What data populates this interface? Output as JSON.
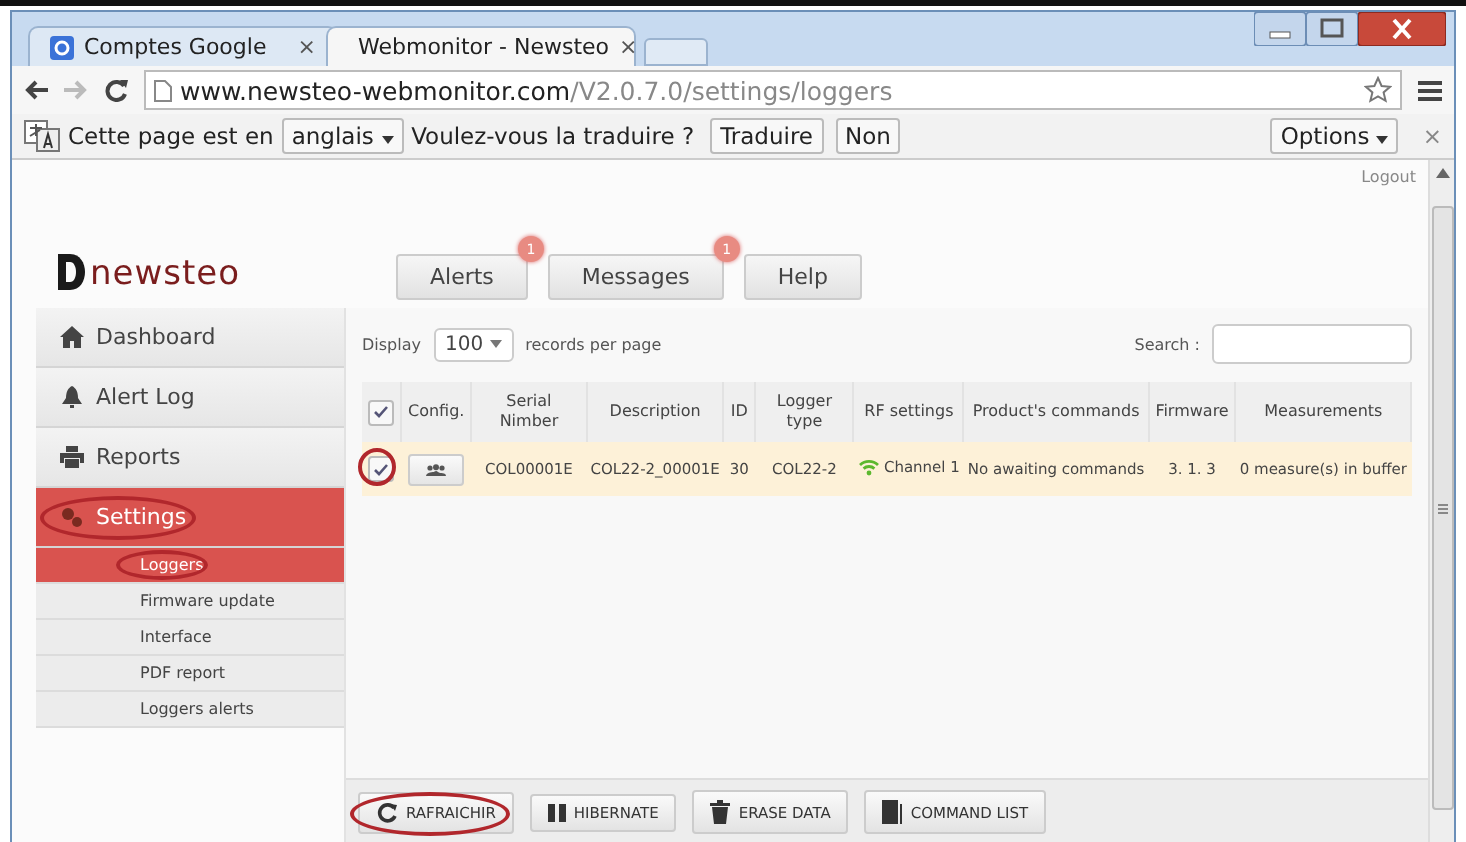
{
  "browser": {
    "tabs": [
      {
        "label": "Comptes Google",
        "close": "×",
        "selected": false
      },
      {
        "label": "Webmonitor - Newsteo",
        "close": "×",
        "selected": true
      }
    ],
    "url": {
      "host": "www.newsteo-webmonitor.com",
      "path": "/V2.0.7.0/settings/loggers"
    }
  },
  "translate_bar": {
    "message": "Cette page est en",
    "language": "anglais",
    "question": "Voulez-vous la traduire ?",
    "buttons": [
      "Traduire",
      "Non"
    ],
    "options": "Options",
    "close": "×"
  },
  "page": {
    "logout": "Logout",
    "logo": {
      "name": "newsteo"
    },
    "header_buttons": [
      {
        "label": "Alerts",
        "badge": "1"
      },
      {
        "label": "Messages",
        "badge": "1"
      },
      {
        "label": "Help"
      }
    ],
    "sidebar": {
      "items": [
        {
          "label": "Dashboard",
          "selected": false,
          "circled": false
        },
        {
          "label": "Alert Log",
          "selected": false,
          "circled": false
        },
        {
          "label": "Reports",
          "selected": false,
          "circled": false
        },
        {
          "label": "Settings",
          "selected": true,
          "circled": true,
          "children": [
            {
              "label": "Loggers",
              "selected": true,
              "circled": true
            },
            {
              "label": "Firmware update",
              "selected": false,
              "circled": false
            },
            {
              "label": "Interface",
              "selected": false,
              "circled": false
            },
            {
              "label": "PDF report",
              "selected": false,
              "circled": false
            },
            {
              "label": "Loggers alerts",
              "selected": false,
              "circled": false
            }
          ]
        }
      ]
    },
    "table": {
      "display_label": "Display",
      "page_size": "100",
      "records_label": "records per page",
      "search_label": "Search :",
      "select_all": {
        "checked": true
      },
      "columns": [
        "Config.",
        "Serial Nimber",
        "Description",
        "ID",
        "Logger type",
        "RF settings",
        "Product's commands",
        "Firmware",
        "Measurements"
      ],
      "rows": [
        {
          "checked": true,
          "circled": true,
          "serial": "COL00001E",
          "description": "COL22-2_00001E",
          "id": "30",
          "logger_type": "COL22-2",
          "rf_settings": "Channel 1",
          "commands": "No awaiting commands",
          "firmware": "3. 1. 3",
          "measurements": "0 measure(s) in buffer"
        }
      ]
    },
    "toolbar": [
      {
        "label": "RAFRAICHIR",
        "circled": true
      },
      {
        "label": "HIBERNATE",
        "circled": false
      },
      {
        "label": "ERASE DATA",
        "circled": false
      },
      {
        "label": "COMMAND LIST",
        "circled": false
      }
    ]
  }
}
